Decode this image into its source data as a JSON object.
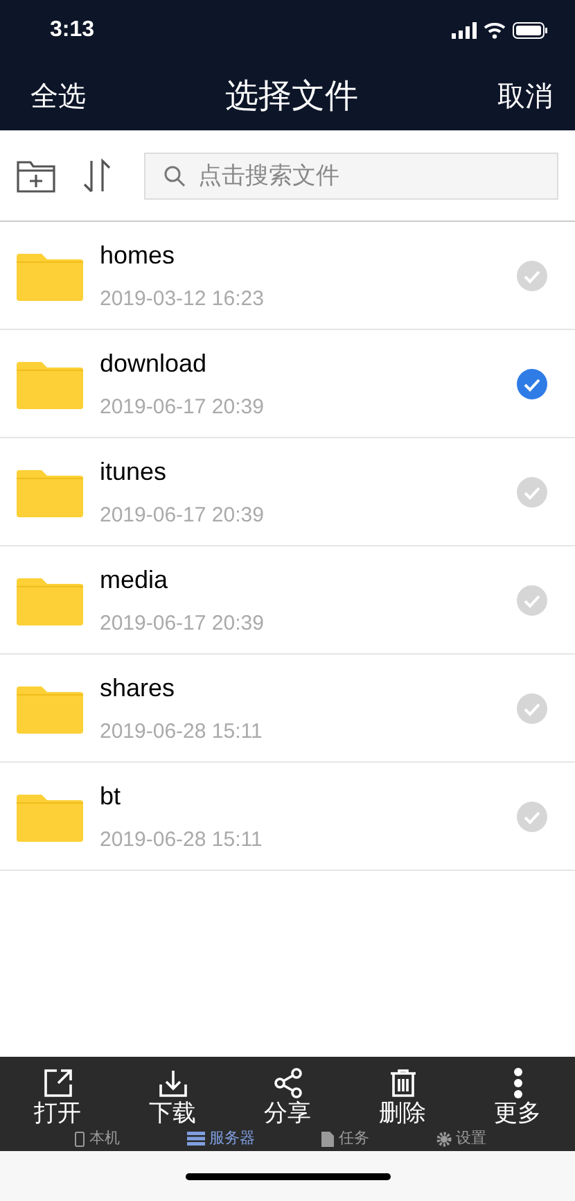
{
  "status_bar": {
    "time": "3:13"
  },
  "nav": {
    "left": "全选",
    "title": "选择文件",
    "right": "取消"
  },
  "search": {
    "placeholder": "点击搜索文件"
  },
  "files": [
    {
      "name": "homes",
      "date": "2019-03-12 16:23",
      "selected": false
    },
    {
      "name": "download",
      "date": "2019-06-17 20:39",
      "selected": true
    },
    {
      "name": "itunes",
      "date": "2019-06-17 20:39",
      "selected": false
    },
    {
      "name": "media",
      "date": "2019-06-17 20:39",
      "selected": false
    },
    {
      "name": "shares",
      "date": "2019-06-28 15:11",
      "selected": false
    },
    {
      "name": "bt",
      "date": "2019-06-28 15:11",
      "selected": false
    }
  ],
  "tab_bar": [
    {
      "kind": "phone",
      "label": "本机",
      "selected": false
    },
    {
      "kind": "server",
      "label": "服务器",
      "selected": true
    },
    {
      "kind": "task",
      "label": "任务",
      "selected": false
    },
    {
      "kind": "settings",
      "label": "设置",
      "selected": false
    }
  ],
  "actions": [
    {
      "kind": "open",
      "label": "打开"
    },
    {
      "kind": "download",
      "label": "下载"
    },
    {
      "kind": "share",
      "label": "分享"
    },
    {
      "kind": "delete",
      "label": "删除"
    },
    {
      "kind": "more",
      "label": "更多"
    }
  ]
}
